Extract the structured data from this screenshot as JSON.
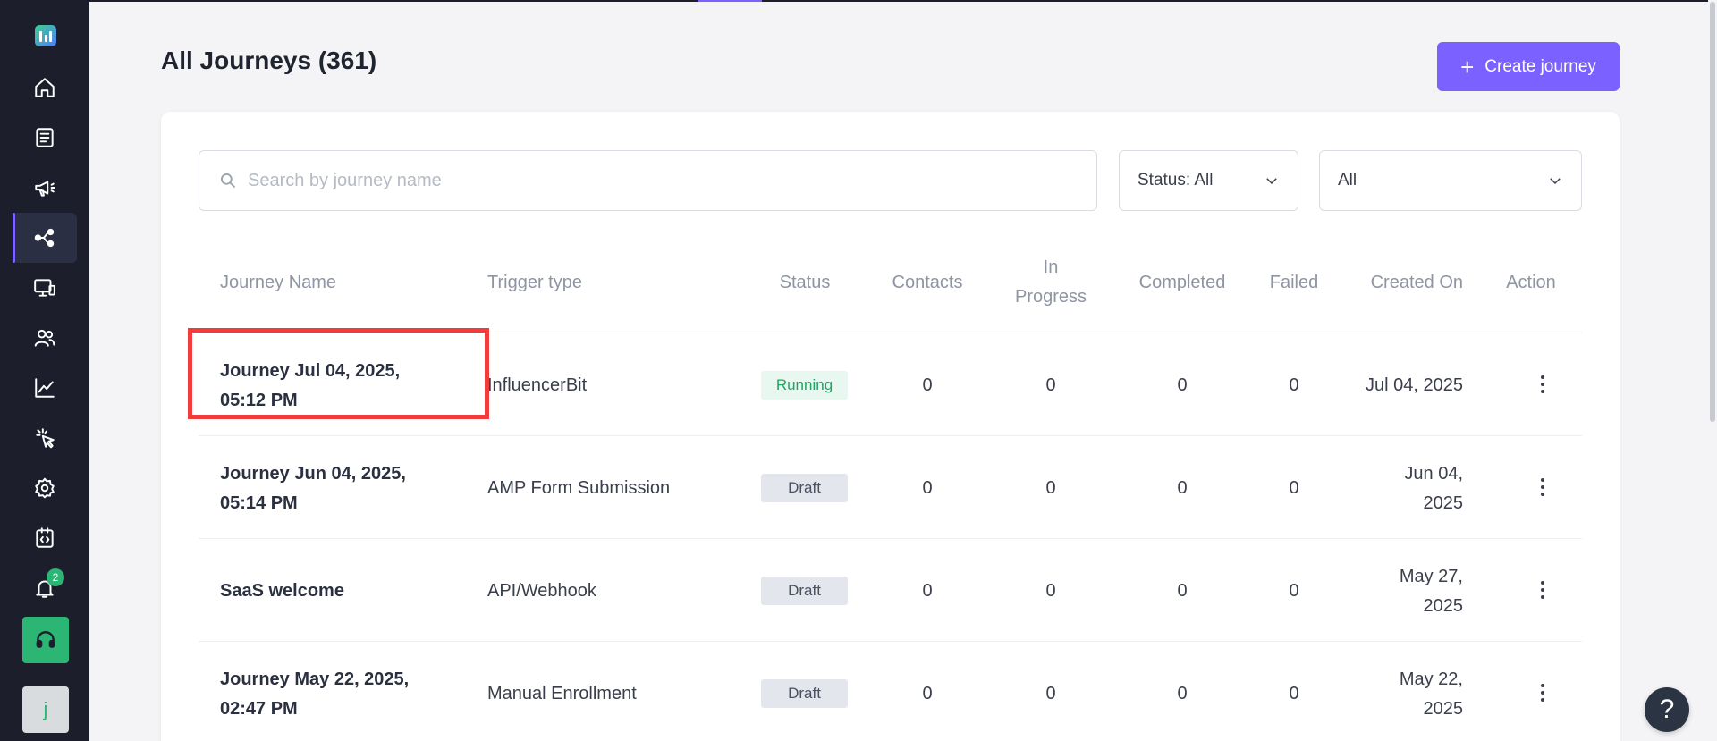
{
  "page": {
    "title": "All Journeys (361)",
    "create_button": {
      "icon": "plus-icon",
      "label": "Create journey"
    }
  },
  "sidebar": {
    "logo": "app-logo",
    "items": [
      {
        "icon": "home-icon",
        "active": false
      },
      {
        "icon": "document-list-icon",
        "active": false
      },
      {
        "icon": "megaphone-icon",
        "active": false
      },
      {
        "icon": "journey-flow-icon",
        "active": true
      },
      {
        "icon": "screen-icon",
        "active": false
      },
      {
        "icon": "users-icon",
        "active": false
      },
      {
        "icon": "analytics-chart-icon",
        "active": false
      },
      {
        "icon": "click-cursor-icon",
        "active": false
      },
      {
        "icon": "settings-gear-icon",
        "active": false
      },
      {
        "icon": "code-icon",
        "active": false
      },
      {
        "icon": "bell-icon",
        "active": false,
        "badge": "2"
      }
    ],
    "support_icon": "headset-icon",
    "avatar_initial": "j"
  },
  "filters": {
    "search_placeholder": "Search by journey name",
    "search_value": "",
    "status_dropdown": "Status: All",
    "type_dropdown": "All"
  },
  "table": {
    "headers": {
      "journey_name": "Journey Name",
      "trigger_type": "Trigger type",
      "status": "Status",
      "contacts": "Contacts",
      "in_progress_1": "In",
      "in_progress_2": "Progress",
      "completed": "Completed",
      "failed": "Failed",
      "created_on": "Created On",
      "action": "Action"
    },
    "rows": [
      {
        "name_1": "Journey Jul 04, 2025,",
        "name_2": "05:12 PM",
        "trigger": "InfluencerBit",
        "status": "Running",
        "contacts": "0",
        "in_progress": "0",
        "completed": "0",
        "failed": "0",
        "created_1": "Jul 04, 2025",
        "created_2": ""
      },
      {
        "name_1": "Journey Jun 04, 2025,",
        "name_2": "05:14 PM",
        "trigger": "AMP Form Submission",
        "status": "Draft",
        "contacts": "0",
        "in_progress": "0",
        "completed": "0",
        "failed": "0",
        "created_1": "Jun 04,",
        "created_2": "2025"
      },
      {
        "name_1": "SaaS welcome",
        "name_2": "",
        "trigger": "API/Webhook",
        "status": "Draft",
        "contacts": "0",
        "in_progress": "0",
        "completed": "0",
        "failed": "0",
        "created_1": "May 27,",
        "created_2": "2025"
      },
      {
        "name_1": "Journey May 22, 2025,",
        "name_2": "02:47 PM",
        "trigger": "Manual Enrollment",
        "status": "Draft",
        "contacts": "0",
        "in_progress": "0",
        "completed": "0",
        "failed": "0",
        "created_1": "May 22,",
        "created_2": "2025"
      }
    ]
  },
  "help_button": "?",
  "colors": {
    "sidebar_bg": "#1c1f2b",
    "accent": "#7b61ff",
    "running_text": "#1fa463",
    "running_bg": "#e8f7ef",
    "draft_bg": "#e3e6ec",
    "highlight": "#f23b3b",
    "support_bg": "#2bb673"
  }
}
